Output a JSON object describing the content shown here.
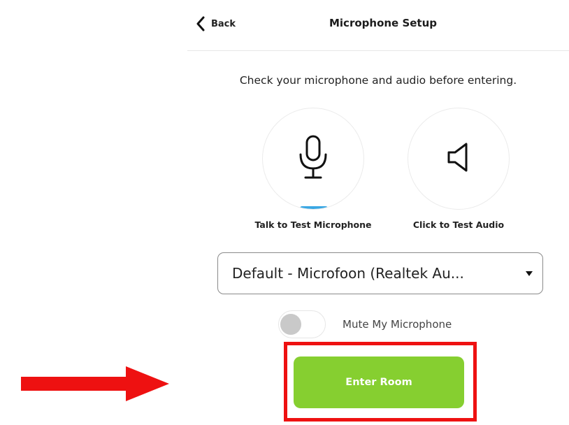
{
  "header": {
    "back_label": "Back",
    "title": "Microphone Setup"
  },
  "instructions": "Check your microphone and audio before entering.",
  "tests": {
    "microphone_label": "Talk to Test Microphone",
    "audio_label": "Click to Test Audio"
  },
  "device_select": {
    "selected": "Default - Microfoon (Realtek Au..."
  },
  "mute_toggle": {
    "label": "Mute My Microphone",
    "on": false
  },
  "enter_button": {
    "label": "Enter Room"
  },
  "icons": {
    "back": "chevron-left-icon",
    "microphone": "microphone-icon",
    "speaker": "speaker-icon",
    "dropdown": "caret-down-icon"
  },
  "colors": {
    "primary_button": "#86cf30",
    "annotation": "#ee1111",
    "mic_level": "#3aa7e3"
  }
}
